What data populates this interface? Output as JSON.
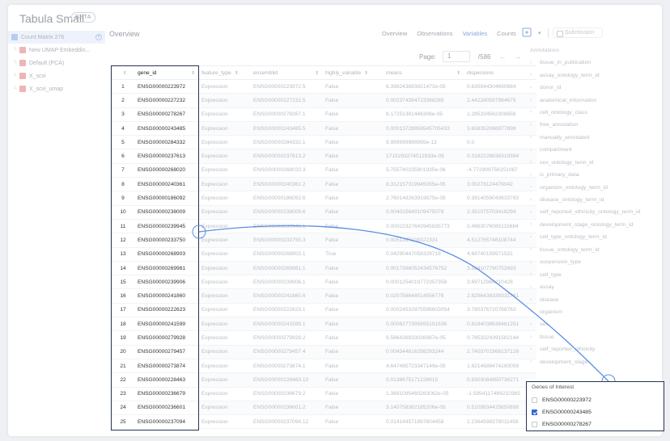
{
  "app": {
    "title": "Tabula Small",
    "badge": "BETA"
  },
  "left_panel": {
    "items": [
      {
        "label": "Count Matrix 276",
        "selected": true
      },
      {
        "label": "New UMAP Embeddin..."
      },
      {
        "label": "Default (PCA)"
      },
      {
        "label": "X_scvi"
      },
      {
        "label": "X_scvi_umap"
      }
    ]
  },
  "header": {
    "title": "Overview",
    "tabs": [
      "Overview",
      "Observations",
      "Variables",
      "Counts"
    ],
    "active_tab": "Variables",
    "submit_label": "Submission"
  },
  "pager": {
    "label": "Page:",
    "value": "1",
    "total": "/586"
  },
  "table": {
    "columns": [
      "",
      "gene_id",
      "feature_type",
      "ensemblid",
      "highly_variable",
      "means",
      "dispersions"
    ],
    "rows": [
      [
        "1",
        "ENSG00000223972",
        "Expression",
        "ENSG00000223972.5",
        "False",
        "6.398243893821473e-05",
        "0.635944304690684"
      ],
      [
        "2",
        "ENSG00000227232",
        "Expression",
        "ENSG00000227232.5",
        "False",
        "0.002374394723368285",
        "2.442280597984675"
      ],
      [
        "3",
        "ENSG00000278267",
        "Expression",
        "ENSG00000278267.1",
        "False",
        "8.17251381446306e-05",
        "1.285334562308658"
      ],
      [
        "4",
        "ENSG00000243485",
        "Expression",
        "ENSG00000243485.5",
        "False",
        "0.00013728859545705433",
        "3.658352066977898"
      ],
      [
        "5",
        "ENSG00000284332",
        "Expression",
        "ENSG00000284332.1",
        "False",
        "9.999999999995e-13",
        "0.0"
      ],
      [
        "6",
        "ENSG00000237613",
        "Expression",
        "ENSG00000237613.2",
        "False",
        "1715283274012933e-05",
        "0.3182228838319394"
      ],
      [
        "7",
        "ENSG00000268020",
        "Expression",
        "ENSG00000268020.3",
        "False",
        "5.755740235901935e-06",
        "-4.772909756251087"
      ],
      [
        "8",
        "ENSG00000240361",
        "Expression",
        "ENSG00000240361.2",
        "False",
        "8.312157319945055e-05",
        "3.00278124479042"
      ],
      [
        "9",
        "ENSG00000186092",
        "Expression",
        "ENSG00000186092.6",
        "False",
        "2.760148263919875e-05",
        "0.3914059043633783"
      ],
      [
        "10",
        "ENSG00000238009",
        "Expression",
        "ENSG00000238009.6",
        "False",
        "0.004015649109475078",
        "2.351075703418294"
      ],
      [
        "11",
        "ENSG00000239945",
        "Expression",
        "ENSG00000239945.1",
        "False",
        "0.00022327643945835773",
        "0.4863076085115684"
      ],
      [
        "12",
        "ENSG00000233750",
        "Expression",
        "ENSG00000233750.3",
        "False",
        "0.0051395108322331",
        "4.512765746108744"
      ],
      [
        "13",
        "ENSG00000268903",
        "Expression",
        "ENSG00000268903.1",
        "True",
        "0.04290447058329718",
        "4.68740159971531"
      ],
      [
        "14",
        "ENSG00000269981",
        "Expression",
        "ENSG00000269981.1",
        "False",
        "0.0017386052434576752",
        "3.324107790752693"
      ],
      [
        "15",
        "ENSG00000239906",
        "Expression",
        "ENSG00000239906.1",
        "False",
        "0.0001254019772357358",
        "3.69712984210428"
      ],
      [
        "16",
        "ENSG00000241860",
        "Expression",
        "ENSG00000241860.6",
        "False",
        "0.020758648514556778",
        "2.8296438339331761"
      ],
      [
        "17",
        "ENSG00000222623",
        "Expression",
        "ENSG00000222623.1",
        "False",
        "0.00024532875596603054",
        "3.785376720768763"
      ],
      [
        "18",
        "ENSG00000241599",
        "Expression",
        "ENSG00000241599.1",
        "False",
        "0.0006277395655191636",
        "0.8164038636461251"
      ],
      [
        "19",
        "ENSG00000279928",
        "Expression",
        "ENSG00000279928.2",
        "False",
        "9.586438833036987e-05",
        "0.7853324391582144"
      ],
      [
        "20",
        "ENSG00000279457",
        "Expression",
        "ENSG00000279457.4",
        "False",
        "0.004344616298293244",
        "2.7403701966137129"
      ],
      [
        "21",
        "ENSG00000273874",
        "Expression",
        "ENSG00000273874.1",
        "False",
        "4.647485723347149e-05",
        "1.8214686474180059"
      ],
      [
        "22",
        "ENSG00000228463",
        "Expression",
        "ENSG00000228463.10",
        "False",
        "0.0138675171228915",
        "0.8303084850736271"
      ],
      [
        "23",
        "ENSG00000236679",
        "Expression",
        "ENSG00000236679.2",
        "False",
        "1.3681095460263062e-05",
        "-1.5954117466210365"
      ],
      [
        "24",
        "ENSG00000236601",
        "Expression",
        "ENSG00000236601.2",
        "False",
        "3.140758362185206e-05",
        "0.5109834425650698"
      ],
      [
        "25",
        "ENSG00000237094",
        "Expression",
        "ENSG00000237094.12",
        "False",
        "0.014144571897604458",
        "1.2364598378011458"
      ]
    ]
  },
  "annotations": {
    "header": "Annotations",
    "items": [
      "tissue_in_publication",
      "assay_ontology_term_id",
      "donor_id",
      "anatomical_information",
      "cell_ontology_class",
      "free_annotation",
      "manually_annotated",
      "compartment",
      "sex_ontology_term_id",
      "is_primary_data",
      "organism_ontology_term_id",
      "disease_ontology_term_id",
      "self_reported_ethnicity_ontology_term_id",
      "development_stage_ontology_term_id",
      "cell_type_ontology_term_id",
      "tissue_ontology_term_id",
      "suspension_type",
      "cell_type",
      "assay",
      "disease",
      "organism",
      "sex",
      "tissue",
      "self_reported_ethnicity",
      "development_stage"
    ]
  },
  "genes_of_interest": {
    "title": "Genes of Interest",
    "items": [
      {
        "label": "ENSG00000223972",
        "checked": false
      },
      {
        "label": "ENSG00000243485",
        "checked": true
      },
      {
        "label": "ENSG00000278267",
        "checked": false
      }
    ]
  },
  "colors": {
    "accent": "#2f67d6",
    "highlight_border": "#26344f",
    "connector": "#5b8ee6"
  }
}
